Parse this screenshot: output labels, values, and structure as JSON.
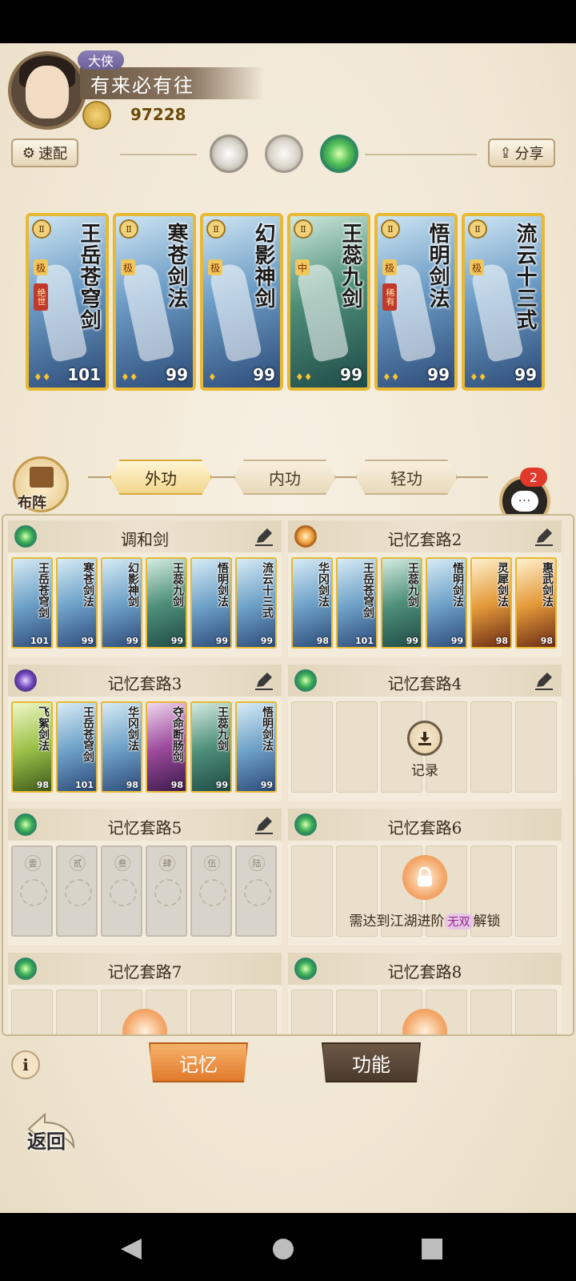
{
  "player": {
    "rank": "大侠",
    "name": "有来必有往",
    "power": "97228"
  },
  "top": {
    "quick_config_label": "速配",
    "share_label": "分享",
    "modes": [
      "moon-mode",
      "sun-mode",
      "jade-mode"
    ]
  },
  "hero_cards": [
    {
      "name": "王岳苍穹剑",
      "tier": "极",
      "tag": "绝世",
      "level": "101"
    },
    {
      "name": "寒苍剑法",
      "tier": "极",
      "tag": "",
      "level": "99"
    },
    {
      "name": "幻影神剑",
      "tier": "极",
      "tag": "",
      "level": "99"
    },
    {
      "name": "王蕊九剑",
      "tier": "中",
      "tag": "",
      "level": "99"
    },
    {
      "name": "悟明剑法",
      "tier": "极",
      "tag": "稀有",
      "level": "99"
    },
    {
      "name": "流云十三式",
      "tier": "极",
      "tag": "",
      "level": "99"
    }
  ],
  "tabs": {
    "outer": "外功",
    "inner": "内功",
    "light": "轻功",
    "layout": "布阵"
  },
  "chat": {
    "badge": "2",
    "glyph": "···"
  },
  "slots": [
    {
      "title": "调和剑",
      "cards": [
        {
          "name": "王岳苍穹剑",
          "level": "101"
        },
        {
          "name": "寒苍剑法",
          "level": "99"
        },
        {
          "name": "幻影神剑",
          "level": "99"
        },
        {
          "name": "王蕊九剑",
          "level": "99"
        },
        {
          "name": "悟明剑法",
          "level": "99"
        },
        {
          "name": "流云十三式",
          "level": "99"
        }
      ]
    },
    {
      "title": "记忆套路2",
      "cards": [
        {
          "name": "华冈剑法",
          "level": "98"
        },
        {
          "name": "王岳苍穹剑",
          "level": "101"
        },
        {
          "name": "王蕊九剑",
          "level": "99"
        },
        {
          "name": "悟明剑法",
          "level": "99"
        },
        {
          "name": "灵犀剑法",
          "level": "98"
        },
        {
          "name": "惠武剑法",
          "level": "98"
        }
      ]
    },
    {
      "title": "记忆套路3",
      "cards": [
        {
          "name": "飞絮剑法",
          "level": "98"
        },
        {
          "name": "王岳苍穹剑",
          "level": "101"
        },
        {
          "name": "华冈剑法",
          "level": "98"
        },
        {
          "name": "夺命断肠剑",
          "level": "98"
        },
        {
          "name": "王蕊九剑",
          "level": "99"
        },
        {
          "name": "悟明剑法",
          "level": "99"
        }
      ]
    },
    {
      "title": "记忆套路4",
      "record_label": "记录"
    },
    {
      "title": "记忆套路5",
      "seals": [
        "壹",
        "贰",
        "叁",
        "肆",
        "伍",
        "陆"
      ]
    },
    {
      "title": "记忆套路6",
      "unlock_prefix": "需达到江湖进阶",
      "unlock_badge": "无双",
      "unlock_suffix": "解锁"
    },
    {
      "title": "记忆套路7"
    },
    {
      "title": "记忆套路8"
    }
  ],
  "bottom": {
    "memory_tab": "记忆",
    "function_tab": "功能",
    "info": "i",
    "back": "返回"
  },
  "system_nav": {
    "back": "◀",
    "home": "●",
    "recent": "■"
  }
}
